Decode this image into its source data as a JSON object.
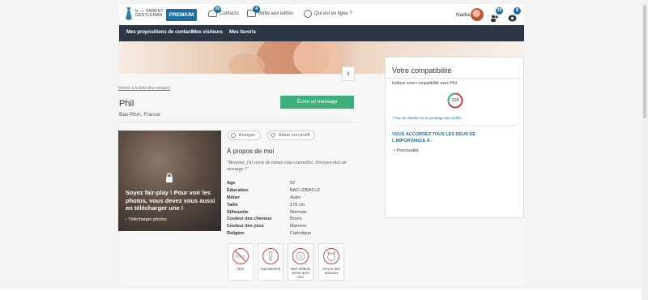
{
  "header": {
    "logo_line1": "le — PARENT",
    "logo_line2": "GENTLEMAN",
    "premium_label": "PREMIUM",
    "contacts": {
      "label": "Contacts",
      "count": "26"
    },
    "inbox": {
      "label": "Boîte aux lettres",
      "count": "4"
    },
    "online": {
      "label": "Qui est en ligne ?"
    },
    "user_name": "Nadia",
    "notif_count": "29",
    "alert_count": "8"
  },
  "subnav": {
    "items": [
      "Mes propositions de contact",
      "Mes visiteurs",
      "Mes favoris"
    ]
  },
  "profile": {
    "back_link": "Retour à la liste des contacts",
    "name": "Phil",
    "location": "Bas-Rhin, France",
    "write_button": "Écrire un message",
    "send_label": "Envoyer",
    "like_label": "Aimer son profil",
    "photo_message": "Soyez fair-play ! Pour voir les photos, vous devez vous aussi en télécharger une !",
    "photo_link": "› Télécharger photos",
    "about_title": "À propos de moi",
    "quote": "\"Bonjour, j'ai envie de mieux vous connaître. Envoyez-moi un message !\"",
    "attributes": [
      {
        "key": "Age",
        "value": "52"
      },
      {
        "key": "Éducation",
        "value": "BAC+2/BAC+3"
      },
      {
        "key": "Métier",
        "value": "Autre"
      },
      {
        "key": "Taille",
        "value": "179 cm"
      },
      {
        "key": "Silhouette",
        "value": "Normale"
      },
      {
        "key": "Couleur des cheveux",
        "value": "Bruns"
      },
      {
        "key": "Couleur des yeux",
        "value": "Marrons"
      },
      {
        "key": "Religion",
        "value": "Catholique"
      }
    ],
    "habits": [
      {
        "label": "Non",
        "icon": "no-smoking-icon"
      },
      {
        "label": "Socialement",
        "icon": "glass-icon"
      },
      {
        "label": "Mes enfants vivent avec moi",
        "icon": "child-face-icon"
      },
      {
        "label": "Amour des animaux",
        "icon": "animal-face-icon"
      }
    ]
  },
  "compatibility": {
    "title": "Votre compatibilité",
    "description": "Indique votre compatibilité avec Phil",
    "score": "109",
    "more_link": "› Plus de détails sur le jumelage des profils",
    "both_heading": "VOUS ACCORDEZ TOUS LES DEUX DE L'IMPORTANCE À :",
    "items": [
      "Ponctualité"
    ]
  },
  "colors": {
    "brand_blue": "#1d6ea3",
    "navbar": "#2c3644",
    "cta_green": "#3bb07d",
    "habit_red": "#d04040"
  }
}
